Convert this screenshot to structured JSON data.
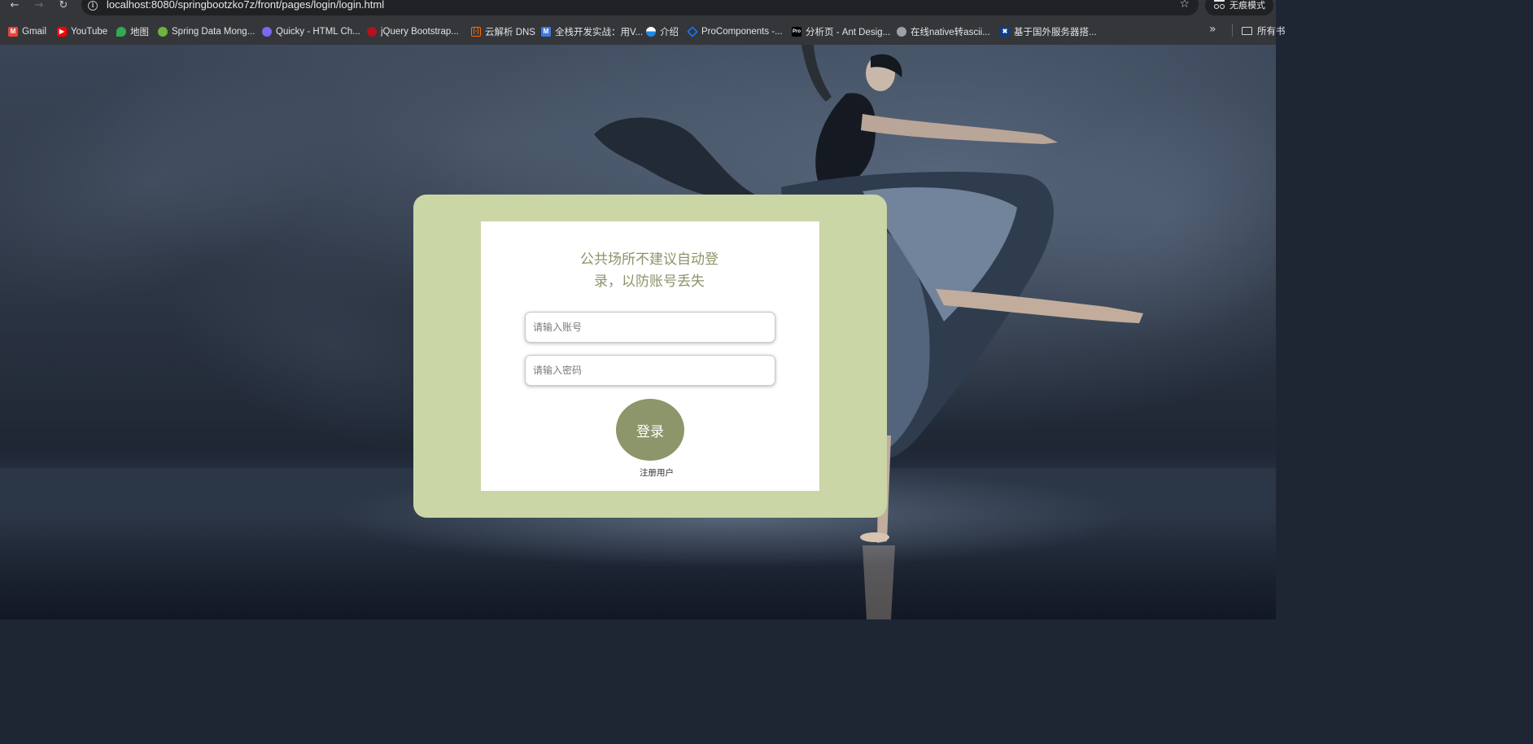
{
  "browser": {
    "url": "localhost:8080/springbootzko7z/front/pages/login/login.html",
    "incognito_label": "无痕模式",
    "bookmarks": [
      {
        "label": "Gmail",
        "icon": "gmail-icon",
        "color": "#ea4335"
      },
      {
        "label": "YouTube",
        "icon": "youtube-icon",
        "color": "#ff0000"
      },
      {
        "label": "地图",
        "icon": "maps-icon",
        "color": "#34a853"
      },
      {
        "label": "Spring Data Mong...",
        "icon": "spring-icon",
        "color": "#6db33f"
      },
      {
        "label": "Quicky - HTML Ch...",
        "icon": "quicky-icon",
        "color": "#7b68ee"
      },
      {
        "label": "jQuery Bootstrap...",
        "icon": "jquery-icon",
        "color": "#b5121b"
      },
      {
        "label": "云解析 DNS",
        "icon": "aliyun-icon",
        "color": "#ff6a00"
      },
      {
        "label": "全栈开发实战：用V...",
        "icon": "m-icon",
        "color": "#3f7be0"
      },
      {
        "label": "介绍",
        "icon": "circle-icon",
        "color": "#1e88e5"
      },
      {
        "label": "ProComponents -...",
        "icon": "antd-icon",
        "color": "#1677ff"
      },
      {
        "label": "分析页 - Ant Desig...",
        "icon": "pro-icon",
        "color": "#000000"
      },
      {
        "label": "在线native转ascii...",
        "icon": "globe-icon",
        "color": "#9aa0a6"
      },
      {
        "label": "基于国外服务器搭...",
        "icon": "flag-icon",
        "color": "#0a3d8f"
      }
    ],
    "all_bookmarks_label": "所有书"
  },
  "login": {
    "notice_line1": "公共场所不建议自动登",
    "notice_line2": "录，以防账号丢失",
    "username_placeholder": "请输入账号",
    "password_placeholder": "请输入密码",
    "login_button": "登录",
    "register_link": "注册用户"
  },
  "colors": {
    "card_outer": "#cad6a6",
    "accent": "#8c966a",
    "notice_text": "#8b9468"
  }
}
